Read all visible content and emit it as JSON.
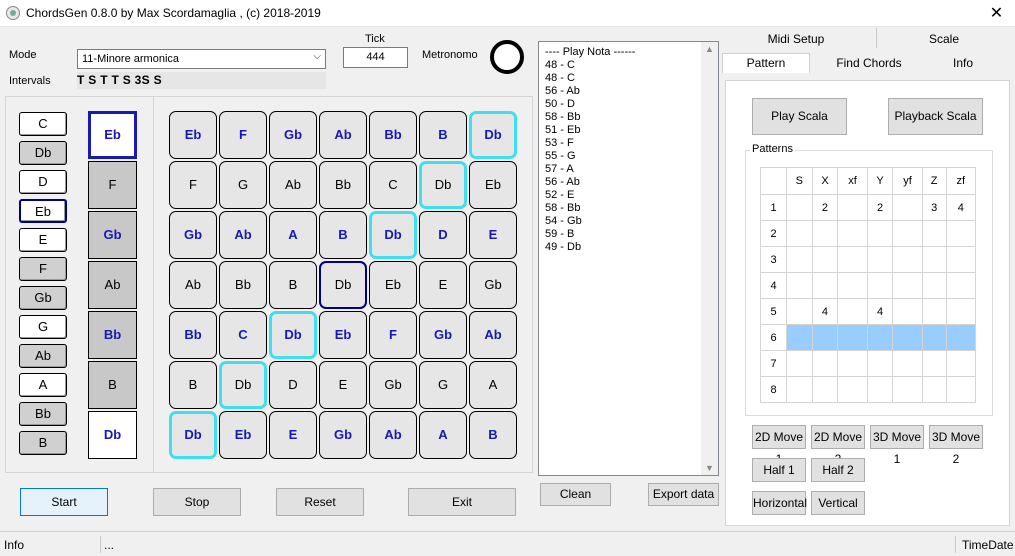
{
  "window": {
    "title": "ChordsGen 0.8.0 by Max Scordamaglia , (c) 2018-2019",
    "close_glyph": "✕"
  },
  "controls": {
    "mode_label": "Mode",
    "mode_value": "11-Minore armonica",
    "intervals_label": "Intervals",
    "intervals_value": "T S T T S 3S S",
    "tick_label": "Tick",
    "tick_value": "444",
    "metronome_label": "Metronomo"
  },
  "chromatic": [
    "C",
    "Db",
    "D",
    "Eb",
    "E",
    "F",
    "Gb",
    "G",
    "Ab",
    "A",
    "Bb",
    "B"
  ],
  "scale": [
    "Eb",
    "F",
    "Gb",
    "Ab",
    "Bb",
    "B",
    "Db"
  ],
  "grid": [
    [
      "Eb",
      "F",
      "Gb",
      "Ab",
      "Bb",
      "B",
      "Db"
    ],
    [
      "F",
      "G",
      "Ab",
      "Bb",
      "C",
      "Db",
      "Eb"
    ],
    [
      "Gb",
      "Ab",
      "A",
      "B",
      "Db",
      "D",
      "E"
    ],
    [
      "Ab",
      "Bb",
      "B",
      "Db",
      "Eb",
      "E",
      "Gb"
    ],
    [
      "Bb",
      "C",
      "Db",
      "Eb",
      "F",
      "Gb",
      "Ab"
    ],
    [
      "B",
      "Db",
      "D",
      "E",
      "Gb",
      "G",
      "A"
    ],
    [
      "Db",
      "Eb",
      "E",
      "Gb",
      "Ab",
      "A",
      "B"
    ]
  ],
  "buttons": {
    "start": "Start",
    "stop": "Stop",
    "reset": "Reset",
    "exit": "Exit",
    "clean": "Clean",
    "export": "Export data"
  },
  "play_list": [
    "---- Play Nota ------",
    "48 - C",
    "48 - C",
    "56 - Ab",
    "50 - D",
    "58 - Bb",
    "51 - Eb",
    "53 - F",
    "55 - G",
    "57 - A",
    "56 - Ab",
    "52 - E",
    "58 - Bb",
    "54 - Gb",
    "59 - B",
    "49 - Db"
  ],
  "tabs": {
    "midi_setup": "Midi Setup",
    "scale": "Scale",
    "pattern": "Pattern",
    "find_chords": "Find Chords",
    "info": "Info"
  },
  "pattern_tab": {
    "play_scala": "Play Scala",
    "playback_scala": "Playback Scala",
    "patterns_label": "Patterns",
    "columns": [
      "S",
      "X",
      "xf",
      "Y",
      "yf",
      "Z",
      "zf"
    ],
    "rows": [
      {
        "n": "1",
        "cells": [
          "",
          "2",
          "",
          "2",
          "",
          "3",
          "4"
        ]
      },
      {
        "n": "2",
        "cells": [
          "",
          "",
          "",
          "",
          "",
          "",
          ""
        ]
      },
      {
        "n": "3",
        "cells": [
          "",
          "",
          "",
          "",
          "",
          "",
          ""
        ]
      },
      {
        "n": "4",
        "cells": [
          "",
          "",
          "",
          "",
          "",
          "",
          ""
        ]
      },
      {
        "n": "5",
        "cells": [
          "",
          "4",
          "",
          "4",
          "",
          "",
          ""
        ]
      },
      {
        "n": "6",
        "cells": [
          "",
          "",
          "",
          "",
          "",
          "",
          ""
        ]
      },
      {
        "n": "7",
        "cells": [
          "",
          "",
          "",
          "",
          "",
          "",
          ""
        ]
      },
      {
        "n": "8",
        "cells": [
          "",
          "",
          "",
          "",
          "",
          "",
          ""
        ]
      }
    ],
    "move_buttons": [
      "2D Move 1",
      "2D Move 2",
      "3D Move 1",
      "3D Move 2"
    ],
    "half_buttons": [
      "Half 1",
      "Half 2"
    ],
    "orient_buttons": [
      "Horizontal",
      "Vertical"
    ]
  },
  "status": {
    "info": "Info",
    "message": "...",
    "timedate": "TimeDate"
  },
  "colors": {
    "scale_text": "#1818b8",
    "highlight": "#3fdfee",
    "root": "#00008a",
    "selected_row": "#99ccff"
  }
}
